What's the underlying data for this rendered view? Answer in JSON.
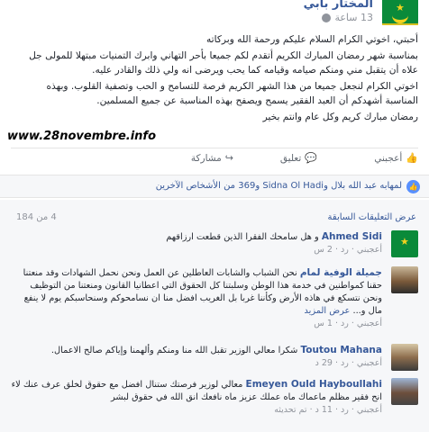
{
  "post": {
    "author": "المختار بابي",
    "time": "13 ساعة",
    "body": [
      "أحبتي، اخوتي الكرام السلام عليكم ورحمة الله وبركاته",
      "بمناسبة شهر رمضان المبارك الكريم أتقدم لكم جميعا بأحر التهاني وابرك التمنيات مبتهلا للمولى جل علاه أن يتقبل مني ومنكم صيامه وقيامه كما يحب ويرضى انه ولي ذلك والقادر عليه.",
      "اخوتي الكرام لنجعل جميعا من هذا الشهر الكريم فرصة للتسامح و الحب وتصفية القلوب. وبهذه المناسبة أشهدكم أن العبد الفقير يسمح ويصفح بهذه المناسبة عن جميع المسلمين.",
      "رمضان مبارك كريم وكل عام وانتم بخير"
    ]
  },
  "watermark": "www.28novembre.info",
  "actions": {
    "like": "أعجبني",
    "comment": "تعليق",
    "share": "مشاركة"
  },
  "reactions": {
    "text": "لمهابه عبد الله بلال وSidna Ol Hadi و369 من الأشخاص الآخرين"
  },
  "comments_section": {
    "previous_link": "عرض التعليقات السابقة",
    "count": "4 من 184",
    "items": [
      {
        "name": "Ahmed Sidi",
        "text": "و هل سامحك الفقرا الذين قطعت ارزاقهم",
        "meta": "أعجبني · رد · 2 س"
      },
      {
        "name": "جميلة الوفية لمام",
        "text": "نحن الشباب والشابات العاطلين عن العمل ونحن نحمل الشهادات وقد منعتنا حقنا كمواطنين في خدمة هذا الوطن وسلبتنا كل الحقوق التي اعطانيا القانون ومنعتنا من التوظيف ونحن نتسكع في هاذه الأرض وكأننا غربا بل الغريب افضل منا ان نسامحوكم وسنحاسبكم يوم لا ينفع مال و...",
        "see_more": "عرض المزيد",
        "meta": "أعجبني · رد · 1 س"
      },
      {
        "name": "Toutou Mahana",
        "text": "شكرا معالي الوزير تقبل الله منا ومنكم وألهمنا وإياكم صالح الاعمال.",
        "meta": "أعجبني · رد · 29 د"
      },
      {
        "name": "Emeyen Ould Hayboullahi",
        "text": "معالي لوزير فرصتك ستنال افضل مع حقوق لخلق عرف عنك لاء انح فقير مظلم ماعماك ماه عملك عزيز ماه نافعك انق الله في حقوق لبشر",
        "meta": "أعجبني · رد · 11 د · تم تحديثه"
      }
    ]
  },
  "colors": {
    "link": "#365899",
    "muted": "#90949c",
    "background_light": "#f6f7f9",
    "flag_green": "#0a8a3a",
    "flag_gold": "#f2d21f"
  }
}
